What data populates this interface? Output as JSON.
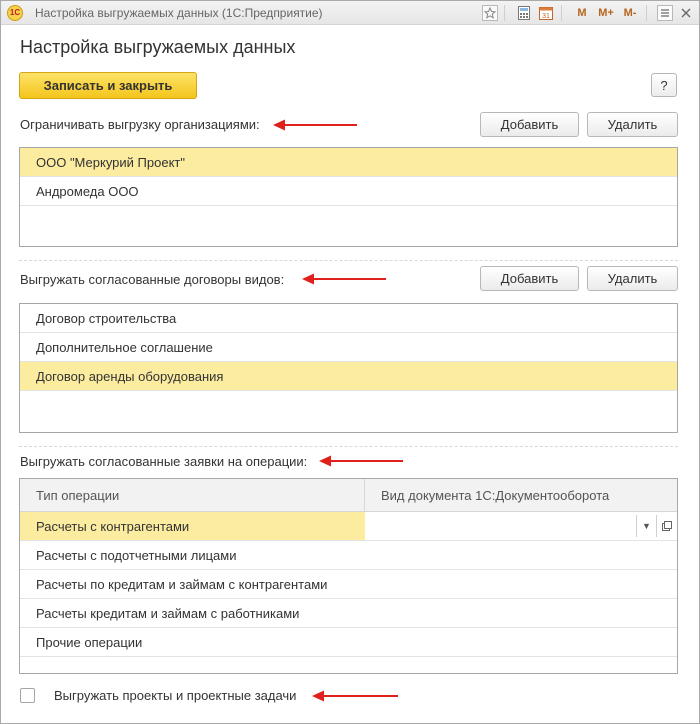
{
  "window": {
    "title": "Настройка выгружаемых данных  (1С:Предприятие)",
    "logo_text": "1С",
    "toolbar_icons": [
      "favorites-icon",
      "calculator-icon",
      "calendar-icon"
    ],
    "mem_buttons": [
      "M",
      "M+",
      "M-"
    ]
  },
  "form": {
    "title": "Настройка выгружаемых данных",
    "save_close_label": "Записать и закрыть",
    "help_label": "?"
  },
  "organizations": {
    "label": "Ограничивать выгрузку организациями:",
    "add_label": "Добавить",
    "delete_label": "Удалить",
    "items": [
      {
        "text": "ООО \"Меркурий Проект\"",
        "selected": true
      },
      {
        "text": "Андромеда ООО",
        "selected": false
      }
    ]
  },
  "contracts": {
    "label": "Выгружать согласованные договоры видов:",
    "add_label": "Добавить",
    "delete_label": "Удалить",
    "items": [
      {
        "text": "Договор строительства",
        "selected": false
      },
      {
        "text": "Дополнительное соглашение",
        "selected": false
      },
      {
        "text": "Договор аренды оборудования",
        "selected": true
      }
    ]
  },
  "operations": {
    "label": "Выгружать согласованные заявки на операции:",
    "col_type": "Тип операции",
    "col_doc": "Вид документа 1С:Документооборота",
    "rows": [
      {
        "type": "Расчеты с контрагентами",
        "doc": "",
        "selected": true
      },
      {
        "type": "Расчеты с подотчетными лицами",
        "doc": "",
        "selected": false
      },
      {
        "type": "Расчеты по кредитам и займам с контрагентами",
        "doc": "",
        "selected": false
      },
      {
        "type": "Расчеты кредитам и займам с работниками",
        "doc": "",
        "selected": false
      },
      {
        "type": "Прочие операции",
        "doc": "",
        "selected": false
      }
    ]
  },
  "projects_checkbox": {
    "label": "Выгружать проекты и проектные задачи",
    "checked": false
  },
  "colors": {
    "accent_yellow": "#f4c51b",
    "selection": "#fbeca0",
    "arrow_red": "#e0201b"
  }
}
